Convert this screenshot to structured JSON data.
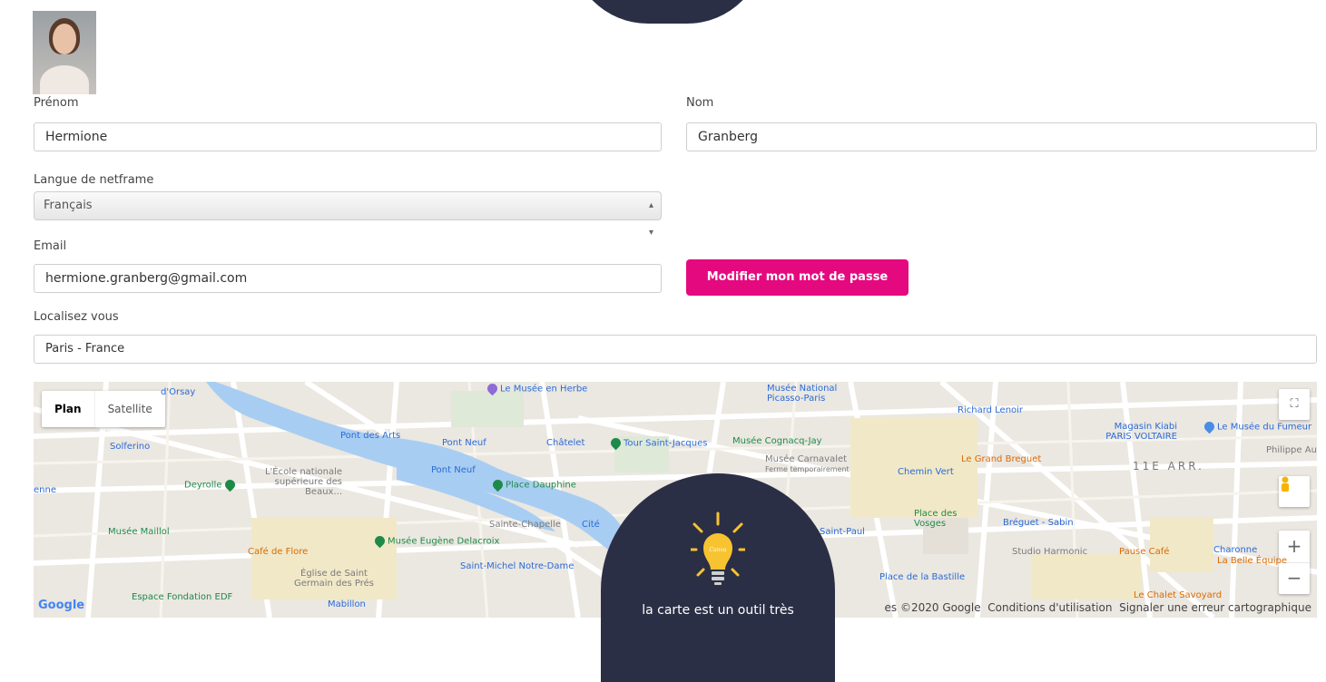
{
  "profile": {
    "first_name_label": "Prénom",
    "first_name_value": "Hermione",
    "last_name_label": "Nom",
    "last_name_value": "Granberg",
    "language_label": "Langue de netframe",
    "language_value": "Français",
    "email_label": "Email",
    "email_value": "hermione.granberg@gmail.com",
    "change_password_label": "Modifier mon mot de passe",
    "location_label": "Localisez vous",
    "location_value": "Paris - France"
  },
  "map": {
    "type_buttons": [
      "Plan",
      "Satellite"
    ],
    "district_label": "11E ARR.",
    "google_logo": "Google",
    "footer": {
      "copyright": "es ©2020 Google",
      "terms": "Conditions d'utilisation",
      "report": "Signaler une erreur cartographique"
    },
    "places": [
      "d'Orsay",
      "Le Musée en Herbe",
      "Musée National Picasso-Paris",
      "Richard Lenoir",
      "Magasin Kiabi PARIS VOLTAIRE",
      "Le Musée du Fumeur",
      "Philippe Au",
      "Solferino",
      "Pont des Arts",
      "Pont Neuf",
      "Châtelet",
      "Tour Saint-Jacques",
      "Musée Cognacq-Jay",
      "Musée Carnavalet",
      "Ferme temporairement",
      "Le Grand Breguet",
      "Chemin Vert",
      "L'École nationale supérieure des Beaux...",
      "Deyrolle",
      "Pont Neuf",
      "Place Dauphine",
      "enne",
      "Sainte-Chapelle",
      "Cité",
      "Musée Maillol",
      "Café de Flore",
      "Musée Eugène Delacroix",
      "Saint-Paul",
      "Place des Vosges",
      "Bréguet - Sabin",
      "Saint-Michel Notre-Dame",
      "Église de Saint Germain des Prés",
      "Mabillon",
      "Espace Fondation EDF",
      "Place de la Bastille",
      "Studio Harmonic",
      "Pause Café",
      "Charonne",
      "La Belle Équipe",
      "Le Chalet Savoyard"
    ],
    "controls": {
      "fullscreen": "fullscreen-icon",
      "pegman": "pegman-icon",
      "zoom_in": "+",
      "zoom_out": "−"
    }
  },
  "tip": {
    "text": "la carte est un outil très",
    "bulb_mark": "Canva"
  },
  "colors": {
    "accent": "#e5097f",
    "dark": "#2b2f45",
    "bulb": "#f7c331"
  }
}
